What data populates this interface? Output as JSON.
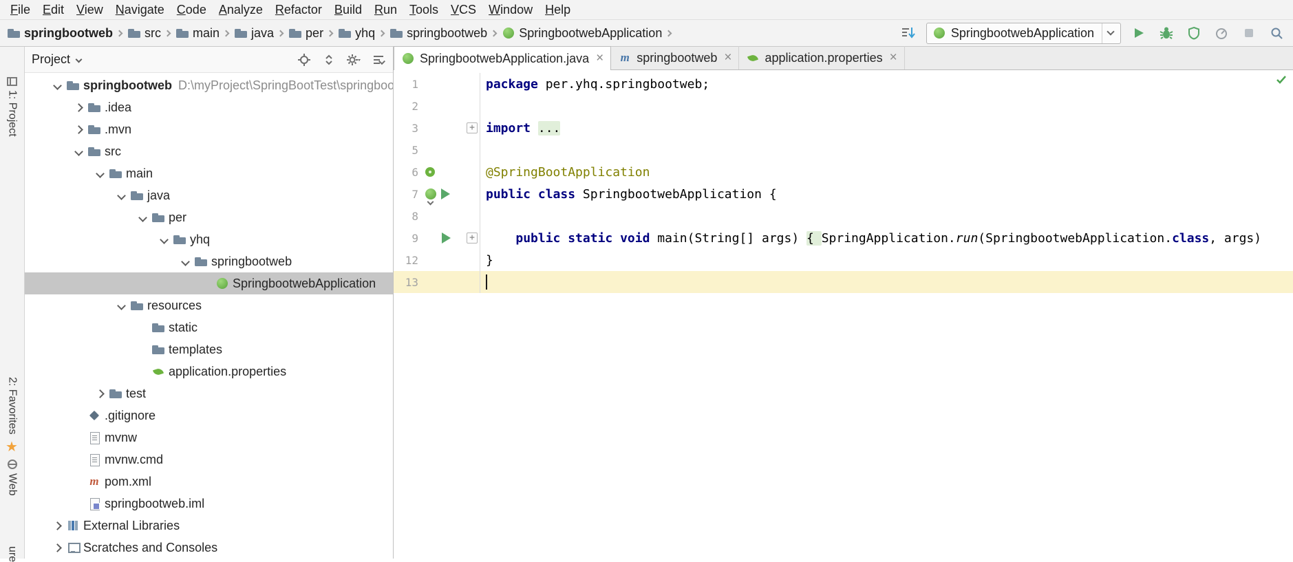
{
  "menu": {
    "items": [
      "File",
      "Edit",
      "View",
      "Navigate",
      "Code",
      "Analyze",
      "Refactor",
      "Build",
      "Run",
      "Tools",
      "VCS",
      "Window",
      "Help"
    ]
  },
  "toolbar": {
    "breadcrumb": [
      {
        "label": "springbootweb",
        "icon": "folder",
        "bold": true
      },
      {
        "label": "src",
        "icon": "folder"
      },
      {
        "label": "main",
        "icon": "folder"
      },
      {
        "label": "java",
        "icon": "folder"
      },
      {
        "label": "per",
        "icon": "folder"
      },
      {
        "label": "yhq",
        "icon": "folder"
      },
      {
        "label": "springbootweb",
        "icon": "folder"
      },
      {
        "label": "SpringbootwebApplication",
        "icon": "spring-class"
      }
    ],
    "run_config": "SpringbootwebApplication"
  },
  "stripe": {
    "project": "1: Project",
    "favorites": "2: Favorites",
    "web": "Web",
    "partial": "ure"
  },
  "project_panel": {
    "title": "Project",
    "tree": [
      {
        "indent": 0,
        "chevron": "down",
        "icon": "folder",
        "label": "springbootweb",
        "bold": true,
        "suffix": "D:\\myProject\\SpringBootTest\\springbootweb"
      },
      {
        "indent": 1,
        "chevron": "right",
        "icon": "folder",
        "label": ".idea"
      },
      {
        "indent": 1,
        "chevron": "right",
        "icon": "folder",
        "label": ".mvn"
      },
      {
        "indent": 1,
        "chevron": "down",
        "icon": "folder",
        "label": "src"
      },
      {
        "indent": 2,
        "chevron": "down",
        "icon": "folder",
        "label": "main"
      },
      {
        "indent": 3,
        "chevron": "down",
        "icon": "folder",
        "label": "java"
      },
      {
        "indent": 4,
        "chevron": "down",
        "icon": "folder",
        "label": "per"
      },
      {
        "indent": 5,
        "chevron": "down",
        "icon": "folder",
        "label": "yhq"
      },
      {
        "indent": 6,
        "chevron": "down",
        "icon": "folder",
        "label": "springbootweb"
      },
      {
        "indent": 7,
        "chevron": null,
        "icon": "spring-class",
        "label": "SpringbootwebApplication",
        "selected": true
      },
      {
        "indent": 3,
        "chevron": "down",
        "icon": "folder",
        "label": "resources"
      },
      {
        "indent": 4,
        "chevron": null,
        "icon": "folder",
        "label": "static"
      },
      {
        "indent": 4,
        "chevron": null,
        "icon": "folder",
        "label": "templates"
      },
      {
        "indent": 4,
        "chevron": null,
        "icon": "spring-leaf",
        "label": "application.properties"
      },
      {
        "indent": 2,
        "chevron": "right",
        "icon": "folder",
        "label": "test"
      },
      {
        "indent": 1,
        "chevron": null,
        "icon": "gitgem",
        "label": ".gitignore"
      },
      {
        "indent": 1,
        "chevron": null,
        "icon": "file",
        "label": "mvnw"
      },
      {
        "indent": 1,
        "chevron": null,
        "icon": "file",
        "label": "mvnw.cmd"
      },
      {
        "indent": 1,
        "chevron": null,
        "icon": "maven-red",
        "label": "pom.xml"
      },
      {
        "indent": 1,
        "chevron": null,
        "icon": "iml",
        "label": "springbootweb.iml"
      },
      {
        "indent": 0,
        "chevron": "right",
        "icon": "libs",
        "label": "External Libraries"
      },
      {
        "indent": 0,
        "chevron": "right",
        "icon": "scratch",
        "label": "Scratches and Consoles"
      }
    ]
  },
  "tabs": [
    {
      "label": "SpringbootwebApplication.java",
      "icon": "spring-class",
      "active": true
    },
    {
      "label": "springbootweb",
      "icon": "maven",
      "active": false
    },
    {
      "label": "application.properties",
      "icon": "spring-leaf",
      "active": false
    }
  ],
  "editor": {
    "lines": [
      {
        "num": "1",
        "segs": [
          {
            "t": "package ",
            "c": "kw"
          },
          {
            "t": "per.yhq.springbootweb;",
            "c": "pl"
          }
        ]
      },
      {
        "num": "2",
        "segs": []
      },
      {
        "num": "3",
        "fold_marker": true,
        "segs": [
          {
            "t": "import ",
            "c": "kw"
          },
          {
            "t": "...",
            "c": "fold"
          }
        ]
      },
      {
        "num": "5",
        "segs": []
      },
      {
        "num": "6",
        "gutter_icon": "spring-bean",
        "segs": [
          {
            "t": "@SpringBootApplication",
            "c": "ann"
          }
        ]
      },
      {
        "num": "7",
        "gutter_icon": "spring-run",
        "segs": [
          {
            "t": "public class ",
            "c": "kw"
          },
          {
            "t": "SpringbootwebApplication {",
            "c": "pl"
          }
        ]
      },
      {
        "num": "8",
        "segs": []
      },
      {
        "num": "9",
        "gutter_icon": "run",
        "fold_marker": true,
        "segs": [
          {
            "t": "    ",
            "c": "pl"
          },
          {
            "t": "public static void ",
            "c": "kw"
          },
          {
            "t": "main(String[] args) ",
            "c": "pl"
          },
          {
            "t": "{ ",
            "c": "fold"
          },
          {
            "t": "SpringApplication.",
            "c": "pl"
          },
          {
            "t": "run",
            "c": "it"
          },
          {
            "t": "(SpringbootwebApplication.",
            "c": "pl"
          },
          {
            "t": "class",
            "c": "kw"
          },
          {
            "t": ", args)",
            "c": "pl"
          }
        ]
      },
      {
        "num": "12",
        "segs": [
          {
            "t": "}",
            "c": "pl"
          }
        ]
      },
      {
        "num": "13",
        "current": true,
        "caret": true,
        "segs": []
      }
    ]
  },
  "colors": {
    "keyword": "#000080",
    "annotation": "#808000",
    "fold_background": "#e1efda",
    "selection": "#c6c6c6",
    "current_line": "#fbf3cc",
    "spring_green": "#6db33f",
    "run_green": "#59a869"
  }
}
